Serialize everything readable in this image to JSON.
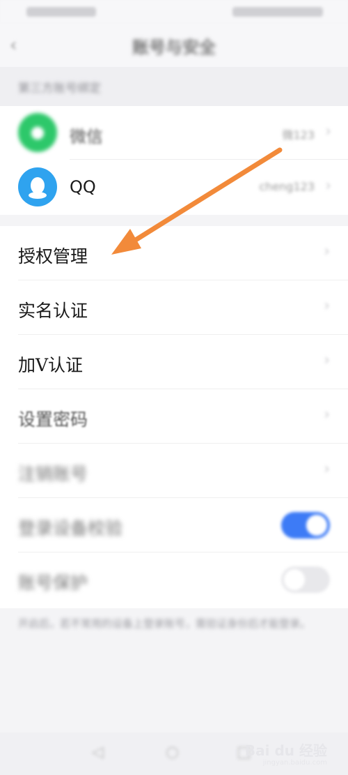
{
  "nav": {
    "title": "账号与安全"
  },
  "section_header": "第三方账号绑定",
  "bindings": [
    {
      "name": "微信",
      "value": "微123",
      "icon": "wechat-icon",
      "color": "#2dc86a"
    },
    {
      "name": "QQ",
      "value": "cheng123",
      "icon": "qq-icon",
      "color": "#2fa3ef"
    }
  ],
  "menu": [
    {
      "label": "授权管理",
      "type": "link"
    },
    {
      "label": "实名认证",
      "type": "link"
    },
    {
      "label": "加V认证",
      "type": "link"
    },
    {
      "label": "设置密码",
      "type": "link"
    },
    {
      "label": "注销账号",
      "type": "link"
    },
    {
      "label": "登录设备校验",
      "type": "toggle",
      "on": true
    },
    {
      "label": "账号保护",
      "type": "toggle",
      "on": false
    }
  ],
  "footer_note": "开启后，若不常用的设备上登录账号，需验证身份后才能登录。",
  "watermark": {
    "text": "Bai du 经验",
    "sub": "jingyan.baidu.com"
  },
  "colors": {
    "accent": "#3d7bf6",
    "arrow": "#f28a3a"
  }
}
